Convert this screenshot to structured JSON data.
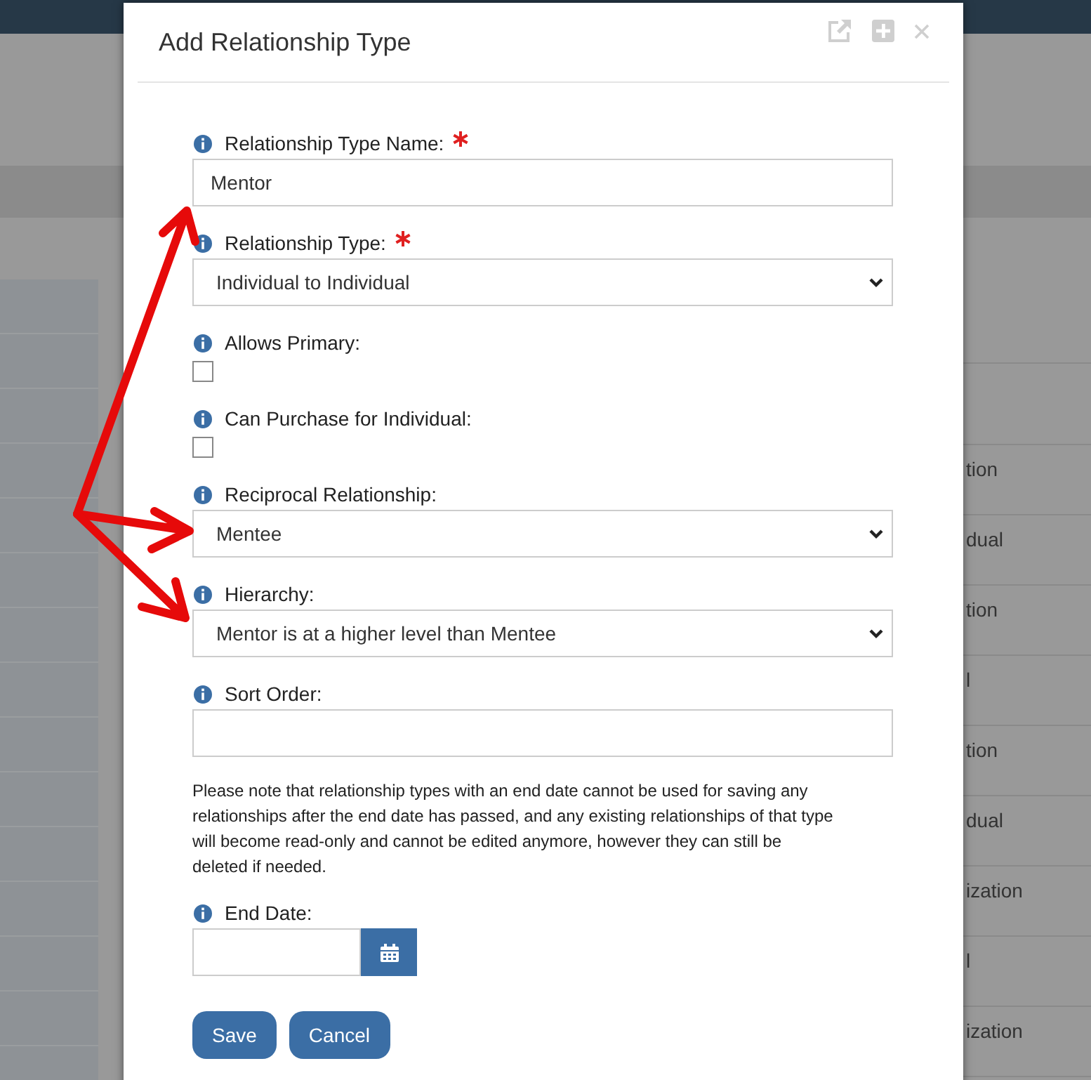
{
  "dialog": {
    "title": "Add Relationship Type",
    "fields": [
      {
        "kind": "text",
        "label": "Relationship Type Name:",
        "required": true,
        "value": "Mentor"
      },
      {
        "kind": "select",
        "label": "Relationship Type:",
        "required": true,
        "value": "Individual to Individual"
      },
      {
        "kind": "checkbox",
        "label": "Allows Primary:",
        "required": false,
        "checked": false
      },
      {
        "kind": "checkbox",
        "label": "Can Purchase for Individual:",
        "required": false,
        "checked": false
      },
      {
        "kind": "select",
        "label": "Reciprocal Relationship:",
        "required": false,
        "value": "Mentee"
      },
      {
        "kind": "select",
        "label": "Hierarchy:",
        "required": false,
        "value": "Mentor is at a higher level than Mentee"
      },
      {
        "kind": "text",
        "label": "Sort Order:",
        "required": false
      }
    ],
    "note": "Please note that relationship types with an end date cannot be used for saving any relationships after the end date has passed, and any existing relationships of that type will become read-only and cannot be edited anymore, however they can still be deleted if needed.",
    "end_date": {
      "label": "End Date:"
    },
    "buttons": [
      "Save",
      "Cancel"
    ]
  },
  "background_table": {
    "rows": [
      "tion",
      "dual",
      "tion",
      "l",
      "tion",
      "dual",
      "ization",
      "l",
      "ization"
    ]
  }
}
